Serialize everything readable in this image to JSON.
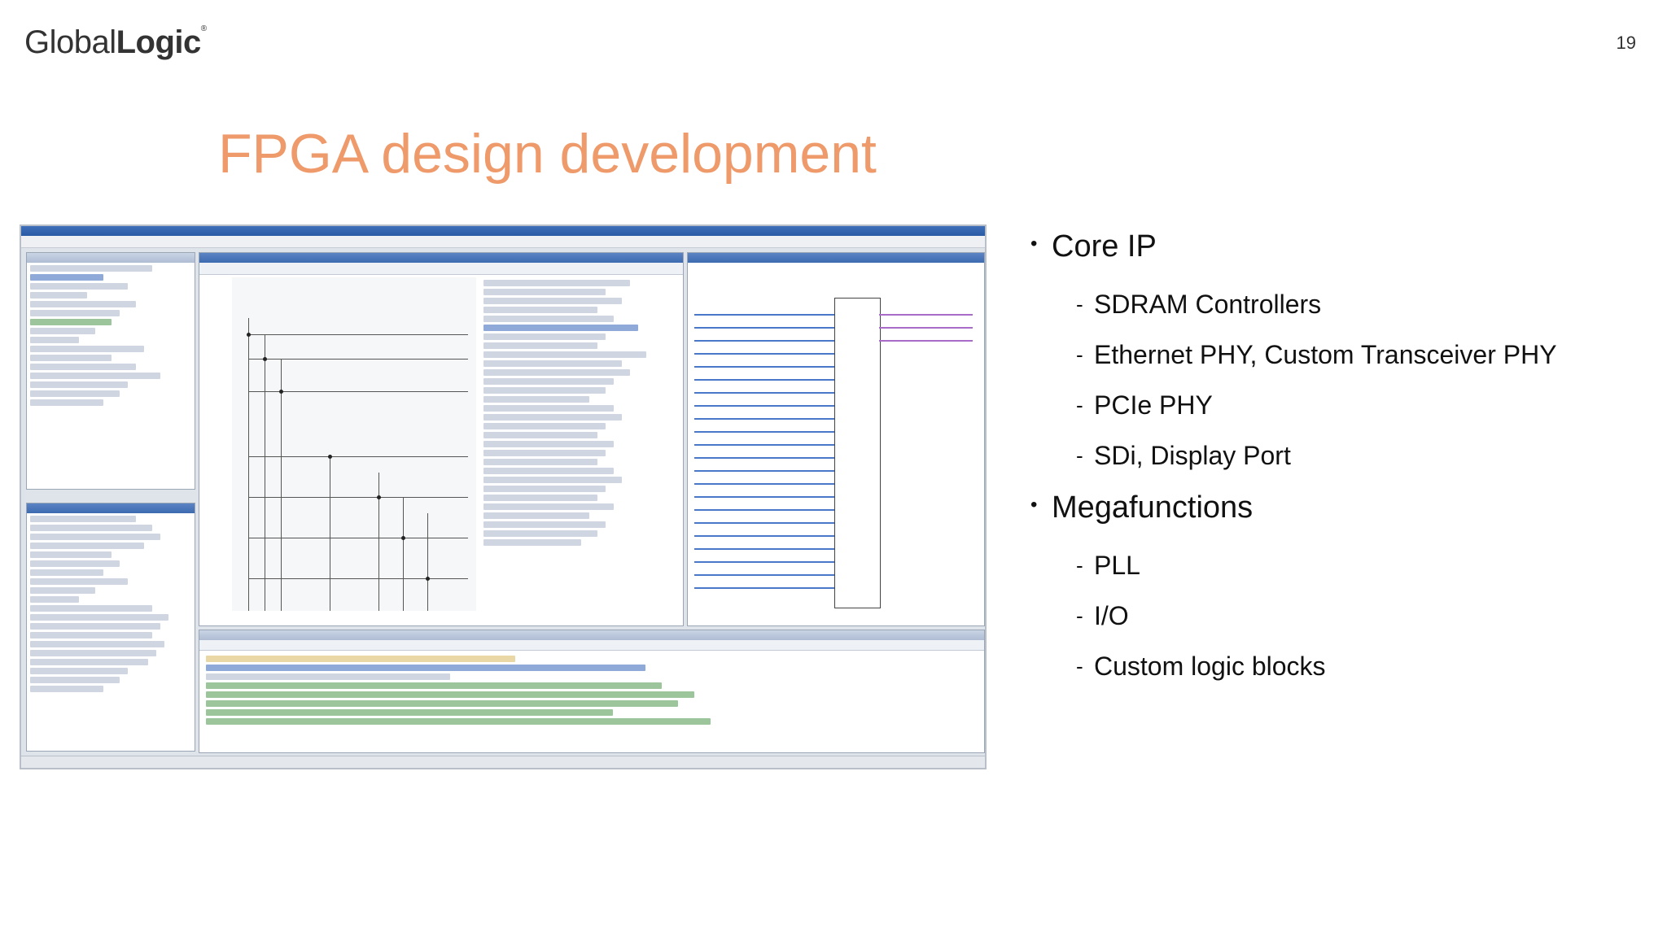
{
  "logo": {
    "regular": "Global",
    "bold": "Logic",
    "mark": "®"
  },
  "page_number": "19",
  "title": "FPGA design development",
  "screenshot_icon": "qsys-window-screenshot",
  "bullets": [
    {
      "label": "Core IP",
      "subs": [
        "SDRAM Controllers",
        "Ethernet PHY, Custom Transceiver PHY",
        "PCIe PHY",
        "SDi, Display Port"
      ]
    },
    {
      "label": "Megafunctions",
      "subs": [
        "PLL",
        "I/O",
        "Custom logic blocks"
      ]
    }
  ]
}
